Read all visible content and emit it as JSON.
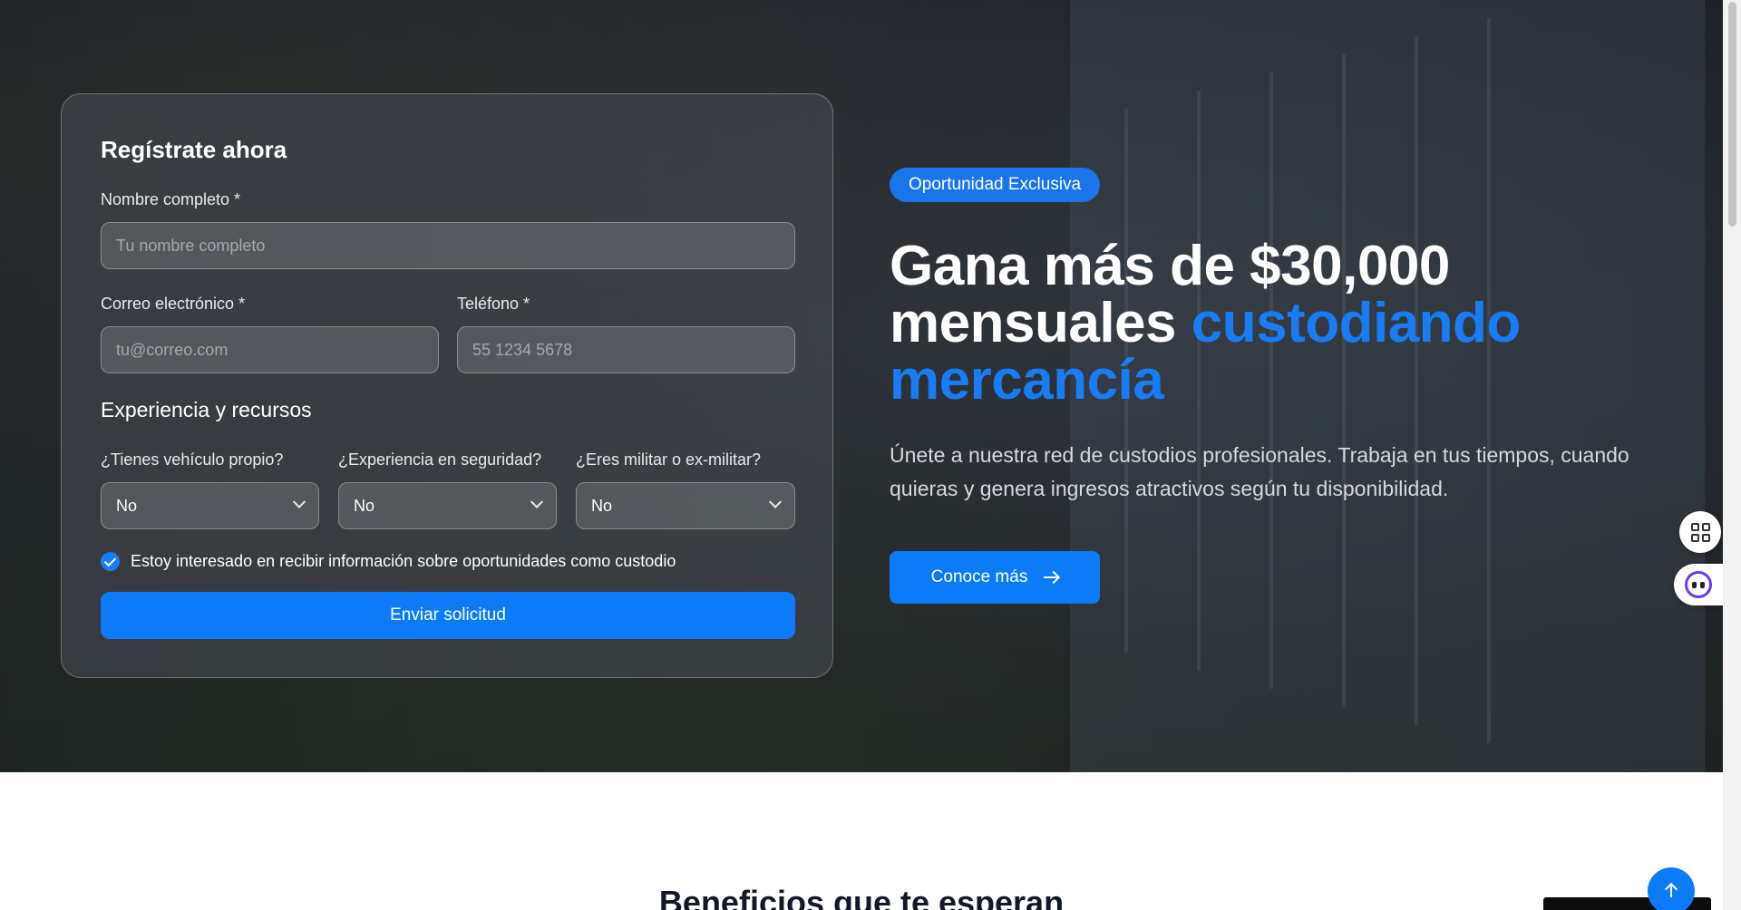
{
  "form": {
    "title": "Regístrate ahora",
    "name_label": "Nombre completo *",
    "name_placeholder": "Tu nombre completo",
    "email_label": "Correo electrónico *",
    "email_placeholder": "tu@correo.com",
    "phone_label": "Teléfono *",
    "phone_placeholder": "55 1234 5678",
    "section_title": "Experiencia y recursos",
    "vehicle_label": "¿Tienes vehículo propio?",
    "vehicle_value": "No",
    "security_label": "¿Experiencia en seguridad?",
    "security_value": "No",
    "military_label": "¿Eres militar o ex-militar?",
    "military_value": "No",
    "consent_text": "Estoy interesado en recibir información sobre oportunidades como custodio",
    "consent_checked": true,
    "submit_label": "Enviar solicitud"
  },
  "hero": {
    "badge": "Oportunidad Exclusiva",
    "headline_white": "Gana más de $30,000 mensuales",
    "headline_accent": "custodiando mercancía",
    "subtitle": "Únete a nuestra red de custodios profesionales. Trabaja en tus tiempos, cuando quieras y genera ingresos atractivos según tu disponibilidad.",
    "cta_label": "Conoce más",
    "accent_color": "#1a7cf5"
  },
  "side_widgets": {
    "apps_icon": "apps-grid-icon",
    "assistant_icon": "assistant-bot-icon"
  },
  "benefits": {
    "title": "Beneficios que te esperan"
  },
  "colors": {
    "primary": "#0d7bf7",
    "heading_dark": "#111827"
  }
}
